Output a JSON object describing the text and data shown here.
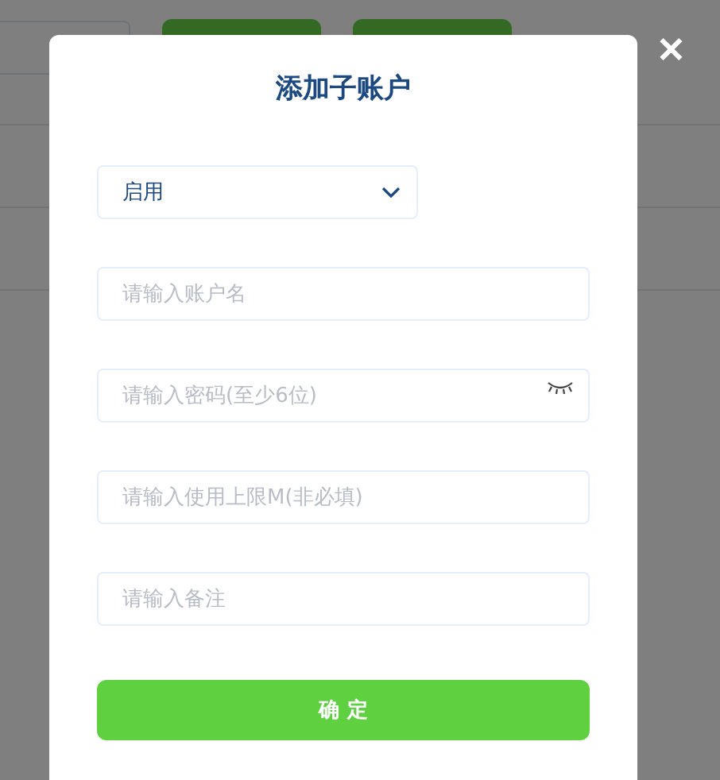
{
  "dialog": {
    "title": "添加子账户",
    "close_icon": "✕"
  },
  "status_select": {
    "value": "启用",
    "expanded": false
  },
  "fields": [
    {
      "placeholder": "请输入账户名",
      "kind": "text"
    },
    {
      "placeholder": "请输入密码(至少6位)",
      "kind": "password"
    },
    {
      "placeholder": "请输入使用上限M(非必填)",
      "kind": "text"
    },
    {
      "placeholder": "请输入备注",
      "kind": "text"
    }
  ],
  "confirm_button": "确 定"
}
